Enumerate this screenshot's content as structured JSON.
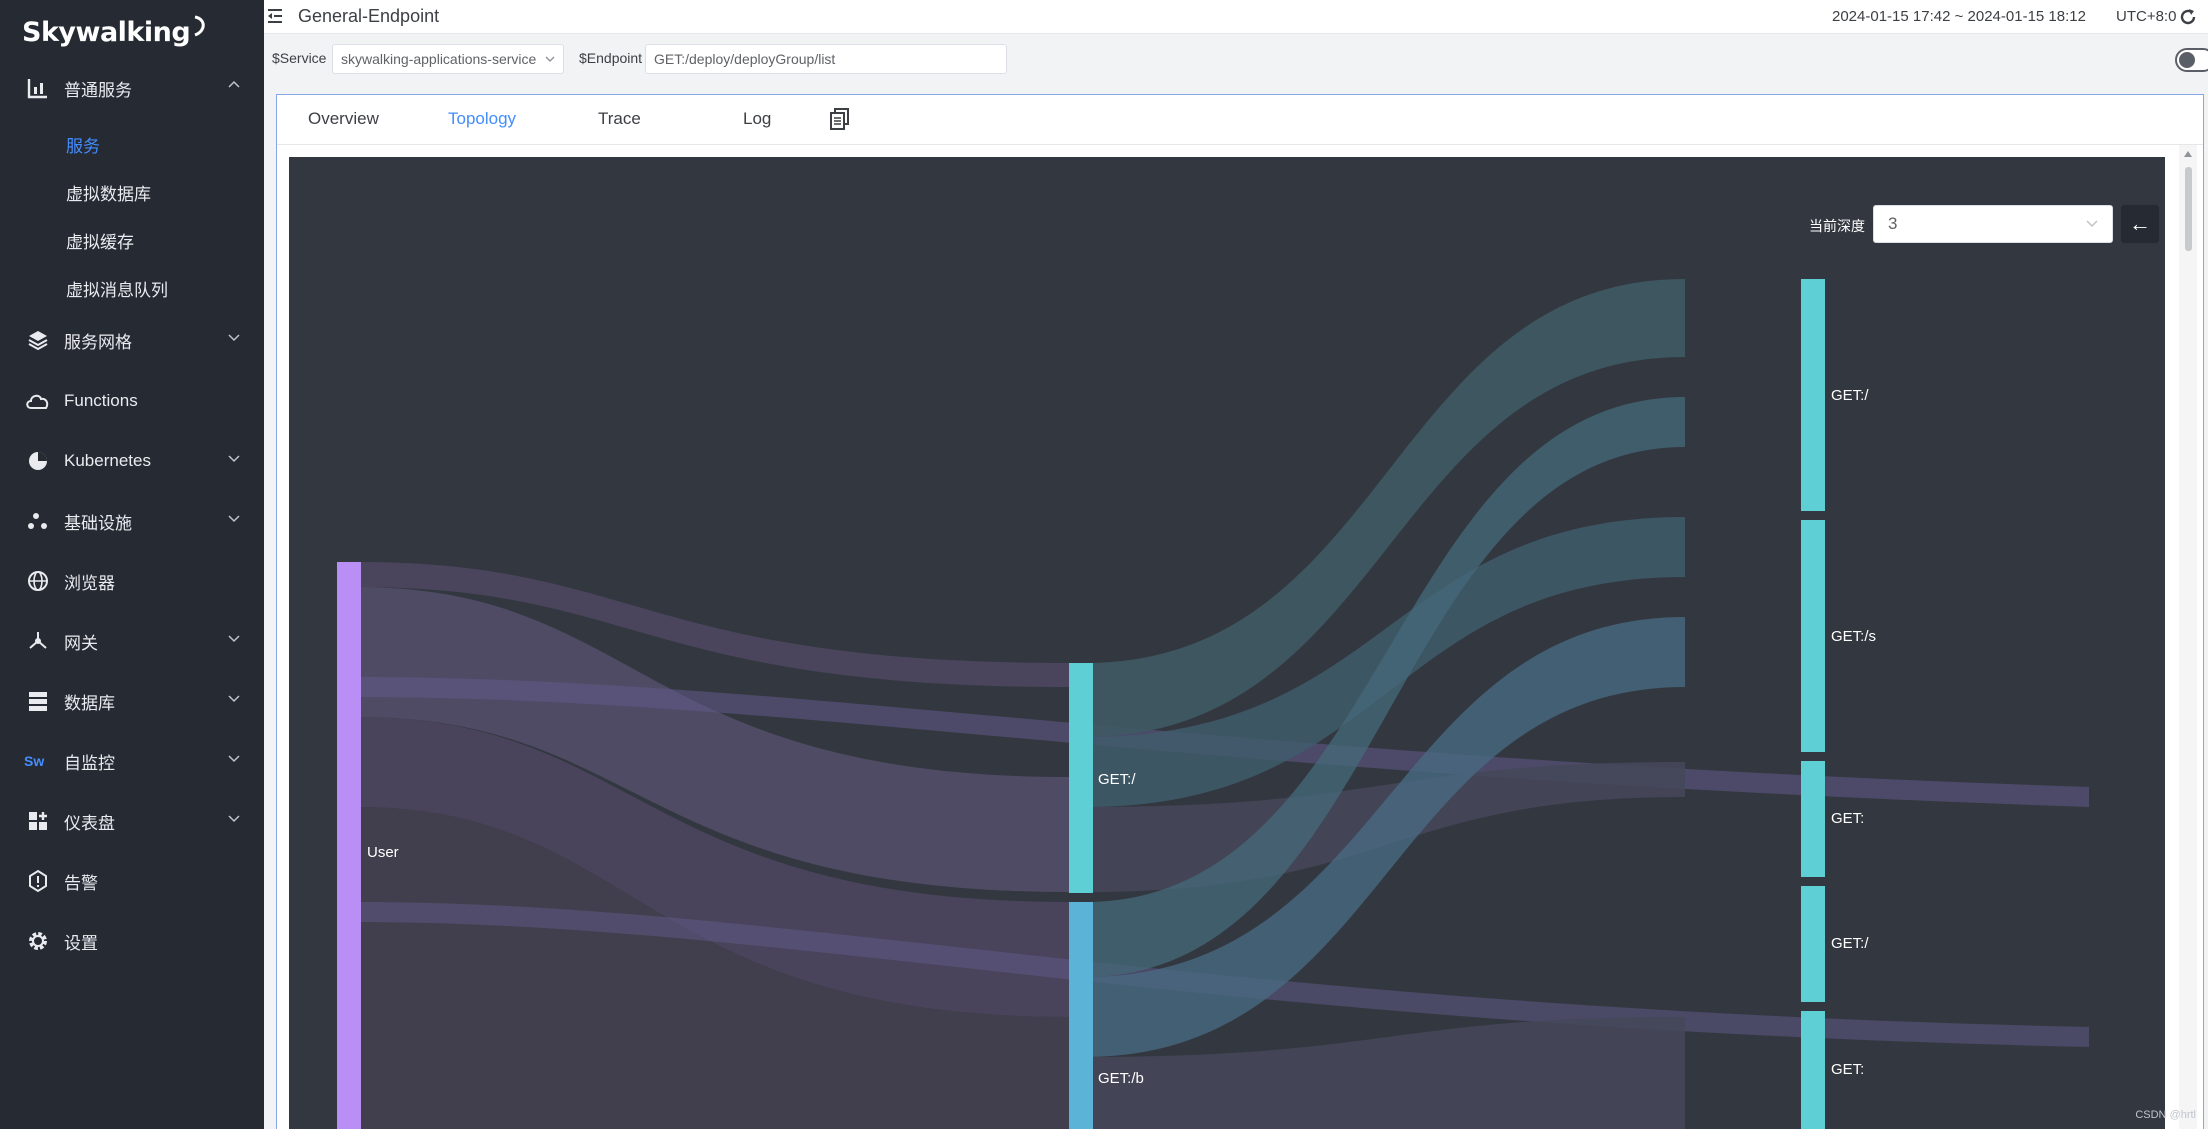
{
  "app": {
    "logo_text": "Skywalking"
  },
  "sidebar": {
    "items": [
      {
        "label": "普通服务",
        "icon": "bar-chart-icon",
        "expanded": true
      },
      {
        "label": "服务网格",
        "icon": "layers-icon"
      },
      {
        "label": "Functions",
        "icon": "cloud-icon"
      },
      {
        "label": "Kubernetes",
        "icon": "pie-icon"
      },
      {
        "label": "基础设施",
        "icon": "dots-icon"
      },
      {
        "label": "浏览器",
        "icon": "globe-icon"
      },
      {
        "label": "网关",
        "icon": "gateway-icon"
      },
      {
        "label": "数据库",
        "icon": "database-icon"
      },
      {
        "label": "自监控",
        "icon": "sw-icon"
      },
      {
        "label": "仪表盘",
        "icon": "dashboard-icon"
      },
      {
        "label": "告警",
        "icon": "alarm-icon"
      },
      {
        "label": "设置",
        "icon": "gear-icon"
      }
    ],
    "sub_items": [
      "服务",
      "虚拟数据库",
      "虚拟缓存",
      "虚拟消息队列"
    ]
  },
  "header": {
    "title": "General-Endpoint",
    "time_range": "2024-01-15 17:42 ~ 2024-01-15 18:12",
    "timezone": "UTC+8:0"
  },
  "selectors": {
    "service_label": "$Service",
    "service_value": "skywalking-applications-service",
    "endpoint_label": "$Endpoint",
    "endpoint_value": "GET:/deploy/deployGroup/list"
  },
  "tabs": [
    "Overview",
    "Topology",
    "Trace",
    "Log"
  ],
  "active_tab": "Topology",
  "topology": {
    "depth_label": "当前深度",
    "depth_value": "3",
    "back_label": "←",
    "nodes": [
      {
        "label": "User",
        "color": "#b98ef5"
      },
      {
        "label": "GET:/",
        "color": "#5ecfd4"
      },
      {
        "label": "GET:/b",
        "color": "#5bb4d8"
      },
      {
        "label": "GET:/",
        "color": "#5ecfd4"
      },
      {
        "label": "GET:/s",
        "color": "#5ecfd4"
      },
      {
        "label": "GET:",
        "color": "#5ecfd4"
      },
      {
        "label": "GET:/",
        "color": "#5ecfd4"
      },
      {
        "label": "GET:",
        "color": "#5ecfd4"
      }
    ]
  },
  "watermark": "CSDN @hrtl"
}
